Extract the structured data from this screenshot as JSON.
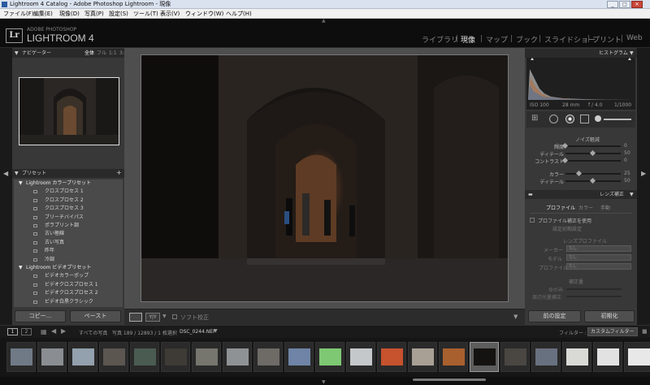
{
  "window": {
    "title": "Lightroom 4 Catalog - Adobe Photoshop Lightroom - 現像",
    "minimize": "_",
    "maximize": "□",
    "close": "✕"
  },
  "menu": [
    "ファイル(F)",
    "編集(E)",
    "現像(D)",
    "写真(P)",
    "設定(S)",
    "ツール(T)",
    "表示(V)",
    "ウィンドウ(W)",
    "ヘルプ(H)"
  ],
  "identity": {
    "badge": "Lr",
    "sub": "ADOBE PHOTOSHOP",
    "name": "LIGHTROOM 4"
  },
  "modules": [
    {
      "label": "ライブラリ",
      "active": false
    },
    {
      "label": "現像",
      "active": true
    },
    {
      "label": "マップ",
      "active": false
    },
    {
      "label": "ブック",
      "active": false
    },
    {
      "label": "スライドショー",
      "active": false
    },
    {
      "label": "プリント",
      "active": false
    },
    {
      "label": "Web",
      "active": false
    }
  ],
  "navigator": {
    "title": "ナビゲーター",
    "zoom_options": [
      "全体",
      "フル",
      "1:1",
      "3:1"
    ]
  },
  "presets": {
    "title": "プリセット",
    "add": "+",
    "groups": [
      {
        "name": "Lightroom カラープリセット",
        "items": [
          "クロスプロセス 1",
          "クロスプロセス 2",
          "クロスプロセス 3",
          "ブリーチバイパス",
          "ポラプリント調",
          "古い極線",
          "古い写真",
          "昨年",
          "冷調"
        ]
      },
      {
        "name": "Lightroom ビデオプリセット",
        "items": [
          "ビデオカラーポップ",
          "ビデオクロスプロセス 1",
          "ビデオクロスプロセス 2",
          "ビデオ白黒クラシック"
        ]
      }
    ]
  },
  "left_buttons": {
    "copy": "コピー...",
    "paste": "ペースト"
  },
  "toolbar": {
    "soft_proof": "ソフト校正",
    "view_mode": "Y|Y"
  },
  "histogram": {
    "title": "ヒストグラム",
    "iso": "ISO 100",
    "focal": "28 mm",
    "aperture": "f / 4.0",
    "shutter": "1/1000"
  },
  "noise_reduction": {
    "title": "ノイズ軽減",
    "sliders": [
      {
        "label": "輝度",
        "value": "0",
        "level": 0.0
      },
      {
        "label": "ディテール",
        "value": "50",
        "level": 0.5
      },
      {
        "label": "コントラスト",
        "value": "0",
        "level": 0.0
      },
      {
        "label": "カラー",
        "value": "25",
        "level": 0.25
      },
      {
        "label": "ディテール",
        "value": "50",
        "level": 0.5
      }
    ]
  },
  "lens_correction": {
    "title": "レンズ補正",
    "tabs": [
      "プロファイル",
      "カラー",
      "手動"
    ],
    "enable_profile": "プロファイル補正を使用",
    "setup_label": "設定",
    "setup_value": "初期設定",
    "lens_profile_title": "レンズプロファイル",
    "maker_label": "メーカー",
    "model_label": "モデル",
    "profile_label": "プロファイル",
    "maker_value": "なし",
    "model_value": "なし",
    "profile_value": "なし",
    "amount_title": "補正量",
    "distortion_label": "ゆがみ",
    "vignette_label": "周辺光量補正"
  },
  "right_buttons": {
    "previous": "前の設定",
    "reset": "初期化"
  },
  "filmbar": {
    "page1": "1",
    "page2": "2",
    "source_label": "すべての写真",
    "photo_count": "写真 189 / 12893 / 1 枚選択",
    "filename": "DSC_0244.NEF",
    "filter_label": "フィルター :",
    "filter_value": "カスタムフィルター"
  },
  "thumbnails": [
    {
      "color": "#6f7a86",
      "active": false
    },
    {
      "color": "#8a8e92",
      "active": false
    },
    {
      "color": "#93a0ad",
      "active": false
    },
    {
      "color": "#5b5650",
      "active": false
    },
    {
      "color": "#4a5b52",
      "active": false
    },
    {
      "color": "#3e3a36",
      "active": false
    },
    {
      "color": "#76766e",
      "active": false
    },
    {
      "color": "#8f9295",
      "active": false
    },
    {
      "color": "#6e6a66",
      "active": false
    },
    {
      "color": "#6f84a6",
      "active": false
    },
    {
      "color": "#7ec873",
      "active": false
    },
    {
      "color": "#c5c8cb",
      "active": false
    },
    {
      "color": "#c7522e",
      "active": false
    },
    {
      "color": "#a9a095",
      "active": false
    },
    {
      "color": "#a8602e",
      "active": false
    },
    {
      "color": "#141312",
      "active": true
    },
    {
      "color": "#4a4743",
      "active": false
    },
    {
      "color": "#687180",
      "active": false
    },
    {
      "color": "#d9d9d6",
      "active": false
    },
    {
      "color": "#e2e2e2",
      "active": false
    },
    {
      "color": "#e8e8e8",
      "active": false
    }
  ]
}
